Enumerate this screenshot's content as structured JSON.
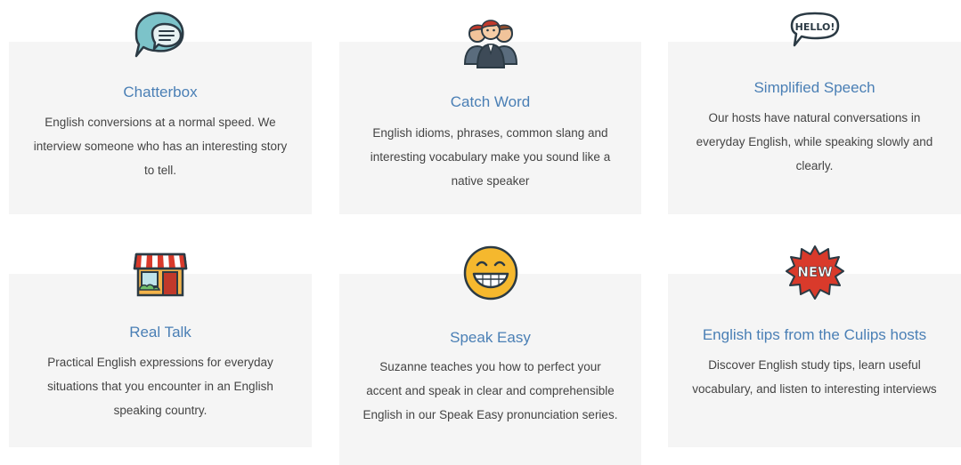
{
  "cards": [
    {
      "icon": "speech-bubble-icon",
      "title": "Chatterbox",
      "description": "English conversions at a normal speed. We interview someone who has an interesting story to tell."
    },
    {
      "icon": "people-group-icon",
      "title": "Catch Word",
      "description": "English idioms, phrases, common slang and interesting vocabulary make you sound like a native speaker"
    },
    {
      "icon": "hello-bubble-icon",
      "icon_text": "HELLO!",
      "title": "Simplified Speech",
      "description": "Our hosts have natural conversations in everyday English, while speaking slowly and clearly."
    },
    {
      "icon": "storefront-icon",
      "title": "Real Talk",
      "description": "Practical English expressions for everyday situations that you encounter in an English speaking country."
    },
    {
      "icon": "smiley-face-icon",
      "title": "Speak Easy",
      "description": "Suzanne teaches you how to perfect your accent and speak in clear and comprehensible English in our Speak Easy pronunciation series."
    },
    {
      "icon": "new-badge-icon",
      "icon_text": "NEW",
      "title": "English tips from the Culips hosts",
      "description": "Discover English study tips, learn useful vocabulary, and listen to interesting interviews"
    }
  ],
  "colors": {
    "card_background": "#f5f5f5",
    "title": "#4a7fb5",
    "description": "#444444",
    "badge_red": "#d93a2b",
    "smiley_yellow": "#f5b82e",
    "bubble_teal": "#7cc3c9"
  }
}
